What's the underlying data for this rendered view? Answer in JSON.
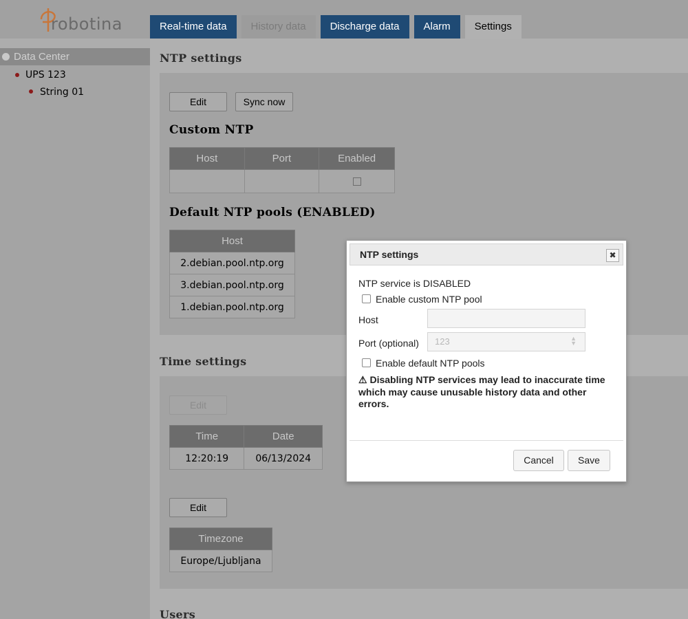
{
  "logo": {
    "text": "robotina"
  },
  "tabs": [
    {
      "label": "Real-time data",
      "state": "normal"
    },
    {
      "label": "History data",
      "state": "disabled"
    },
    {
      "label": "Discharge data",
      "state": "normal"
    },
    {
      "label": "Alarm",
      "state": "normal"
    },
    {
      "label": "Settings",
      "state": "active"
    }
  ],
  "sidebar": {
    "root": "Data Center",
    "items": [
      {
        "label": "UPS 123"
      },
      {
        "label": "String 01"
      }
    ]
  },
  "ntp": {
    "section_title": "NTP settings",
    "edit_label": "Edit",
    "sync_label": "Sync now",
    "custom_title": "Custom NTP",
    "custom_headers": [
      "Host",
      "Port",
      "Enabled"
    ],
    "custom_row": {
      "host": "",
      "port": "",
      "enabled": false
    },
    "pools_title": "Default NTP pools (ENABLED)",
    "pools_header": "Host",
    "pools": [
      "2.debian.pool.ntp.org",
      "3.debian.pool.ntp.org",
      "1.debian.pool.ntp.org"
    ]
  },
  "time": {
    "section_title": "Time settings",
    "edit_label": "Edit",
    "headers": [
      "Time",
      "Date"
    ],
    "time_value": "12:20:19",
    "date_value": "06/13/2024",
    "tz_edit_label": "Edit",
    "tz_header": "Timezone",
    "tz_value": "Europe/Ljubljana"
  },
  "users": {
    "section_title": "Users"
  },
  "modal": {
    "title": "NTP settings",
    "close_symbol": "✖",
    "status": "NTP service is DISABLED",
    "custom_pool_label": "Enable custom NTP pool",
    "host_label": "Host",
    "host_value": "",
    "port_label": "Port (optional)",
    "port_placeholder": "123",
    "default_pools_label": "Enable default NTP pools",
    "warning_icon": "⚠",
    "warning": "Disabling NTP services may lead to inaccurate time which may cause unusable history data and other errors.",
    "cancel_label": "Cancel",
    "save_label": "Save"
  },
  "colors": {
    "tab_blue": "#1f4a74",
    "dot_red": "#8b1a1a",
    "logo_orange": "#c8763a"
  }
}
